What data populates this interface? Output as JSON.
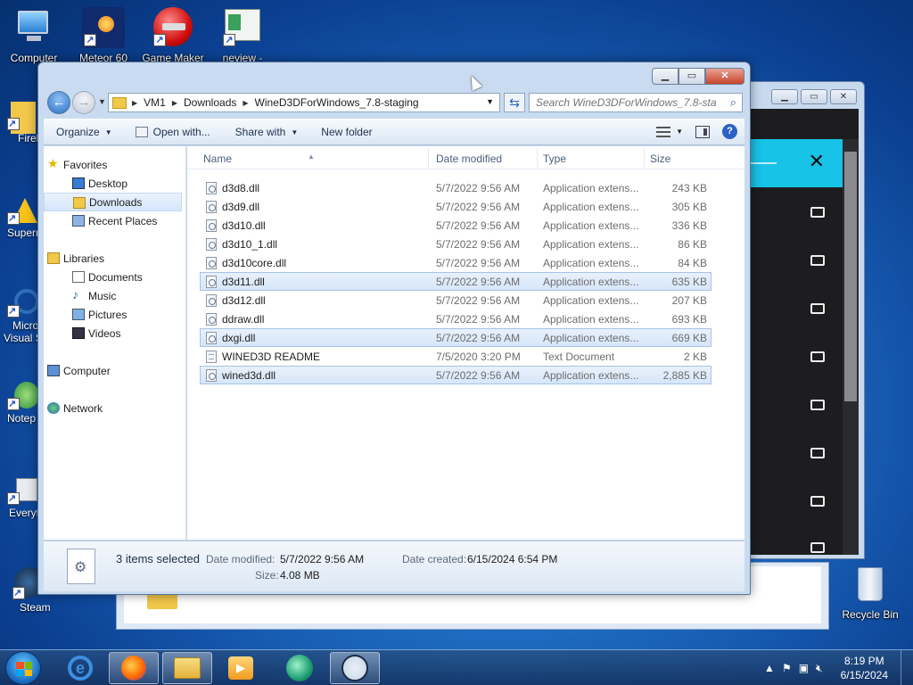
{
  "desktop": {
    "icons_top": [
      {
        "label": "Computer"
      },
      {
        "label": "Meteor 60"
      },
      {
        "label": "Game Maker"
      },
      {
        "label": "neview -"
      }
    ],
    "icons_left": [
      {
        "label": "Firel"
      },
      {
        "label": "Superr"
      },
      {
        "label": "Micro"
      },
      {
        "label": "Visual S"
      },
      {
        "label": "Notep"
      },
      {
        "label": "Everyt"
      },
      {
        "label": "Steam"
      }
    ],
    "recycle_bin": "Recycle Bin"
  },
  "explorer": {
    "breadcrumb": [
      "VM1",
      "Downloads",
      "WineD3DForWindows_7.8-staging"
    ],
    "search_placeholder": "Search WineD3DForWindows_7.8-sta...",
    "toolbar": {
      "organize": "Organize",
      "open_with": "Open with...",
      "share_with": "Share with",
      "new_folder": "New folder"
    },
    "nav": {
      "favorites": "Favorites",
      "desktop": "Desktop",
      "downloads": "Downloads",
      "recent_places": "Recent Places",
      "libraries": "Libraries",
      "documents": "Documents",
      "music": "Music",
      "pictures": "Pictures",
      "videos": "Videos",
      "computer": "Computer",
      "network": "Network"
    },
    "columns": {
      "name": "Name",
      "date": "Date modified",
      "type": "Type",
      "size": "Size"
    },
    "files": [
      {
        "name": "d3d8.dll",
        "date": "5/7/2022 9:56 AM",
        "type": "Application extens...",
        "size": "243 KB",
        "selected": false,
        "kind": "dll"
      },
      {
        "name": "d3d9.dll",
        "date": "5/7/2022 9:56 AM",
        "type": "Application extens...",
        "size": "305 KB",
        "selected": false,
        "kind": "dll"
      },
      {
        "name": "d3d10.dll",
        "date": "5/7/2022 9:56 AM",
        "type": "Application extens...",
        "size": "336 KB",
        "selected": false,
        "kind": "dll"
      },
      {
        "name": "d3d10_1.dll",
        "date": "5/7/2022 9:56 AM",
        "type": "Application extens...",
        "size": "86 KB",
        "selected": false,
        "kind": "dll"
      },
      {
        "name": "d3d10core.dll",
        "date": "5/7/2022 9:56 AM",
        "type": "Application extens...",
        "size": "84 KB",
        "selected": false,
        "kind": "dll"
      },
      {
        "name": "d3d11.dll",
        "date": "5/7/2022 9:56 AM",
        "type": "Application extens...",
        "size": "635 KB",
        "selected": true,
        "kind": "dll"
      },
      {
        "name": "d3d12.dll",
        "date": "5/7/2022 9:56 AM",
        "type": "Application extens...",
        "size": "207 KB",
        "selected": false,
        "kind": "dll"
      },
      {
        "name": "ddraw.dll",
        "date": "5/7/2022 9:56 AM",
        "type": "Application extens...",
        "size": "693 KB",
        "selected": false,
        "kind": "dll"
      },
      {
        "name": "dxgi.dll",
        "date": "5/7/2022 9:56 AM",
        "type": "Application extens...",
        "size": "669 KB",
        "selected": true,
        "kind": "dll"
      },
      {
        "name": "WINED3D README",
        "date": "7/5/2020 3:20 PM",
        "type": "Text Document",
        "size": "2 KB",
        "selected": false,
        "kind": "txt"
      },
      {
        "name": "wined3d.dll",
        "date": "5/7/2022 9:56 AM",
        "type": "Application extens...",
        "size": "2,885 KB",
        "selected": true,
        "kind": "dll"
      }
    ],
    "details": {
      "count": "3 items selected",
      "date_modified_label": "Date modified:",
      "date_modified": "5/7/2022 9:56 AM",
      "date_created_label": "Date created:",
      "date_created": "6/15/2024 6:54 PM",
      "size_label": "Size:",
      "size": "4.08 MB"
    }
  },
  "taskbar": {
    "time": "8:19 PM",
    "date": "6/15/2024"
  }
}
